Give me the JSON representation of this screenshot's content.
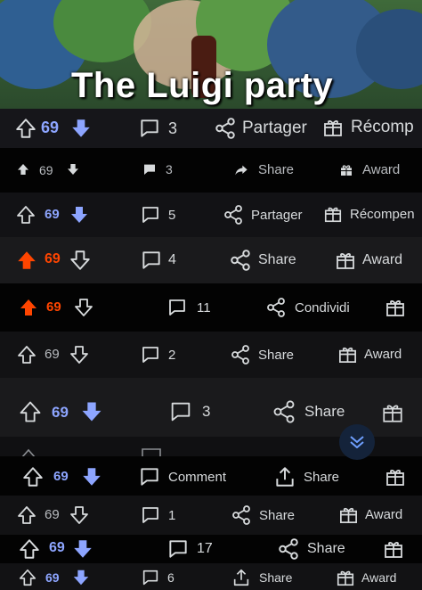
{
  "meme": {
    "caption": "The Luigi party"
  },
  "rows": [
    {
      "vote_count": "69",
      "comments": "3",
      "share_label": "Partager",
      "award_label": "Récomp"
    },
    {
      "vote_count": "69",
      "comments": "3",
      "share_label": "Share",
      "award_label": "Award"
    },
    {
      "vote_count": "69",
      "comments": "5",
      "share_label": "Partager",
      "award_label": "Récompen"
    },
    {
      "vote_count": "69",
      "comments": "4",
      "share_label": "Share",
      "award_label": "Award"
    },
    {
      "vote_count": "69",
      "comments": "11",
      "share_label": "Condividi",
      "award_label": ""
    },
    {
      "vote_count": "69",
      "comments": "2",
      "share_label": "Share",
      "award_label": "Award"
    },
    {
      "vote_count": "69",
      "comments": "3",
      "share_label": "Share",
      "award_label": ""
    },
    {
      "vote_count": "69",
      "comments": "Comment",
      "share_label": "Share",
      "award_label": ""
    },
    {
      "vote_count": "69",
      "comments": "1",
      "share_label": "Share",
      "award_label": "Award"
    },
    {
      "vote_count": "69",
      "comments": "17",
      "share_label": "Share",
      "award_label": ""
    },
    {
      "vote_count": "69",
      "comments": "6",
      "share_label": "Share",
      "award_label": "Award"
    }
  ],
  "colors": {
    "upvote": "#ff4500",
    "highlight": "#8da5ff",
    "text": "#d7dadc"
  },
  "icons": [
    "upvote-icon",
    "downvote-icon",
    "comment-icon",
    "share-icon",
    "award-icon",
    "chevron-down-icon"
  ]
}
